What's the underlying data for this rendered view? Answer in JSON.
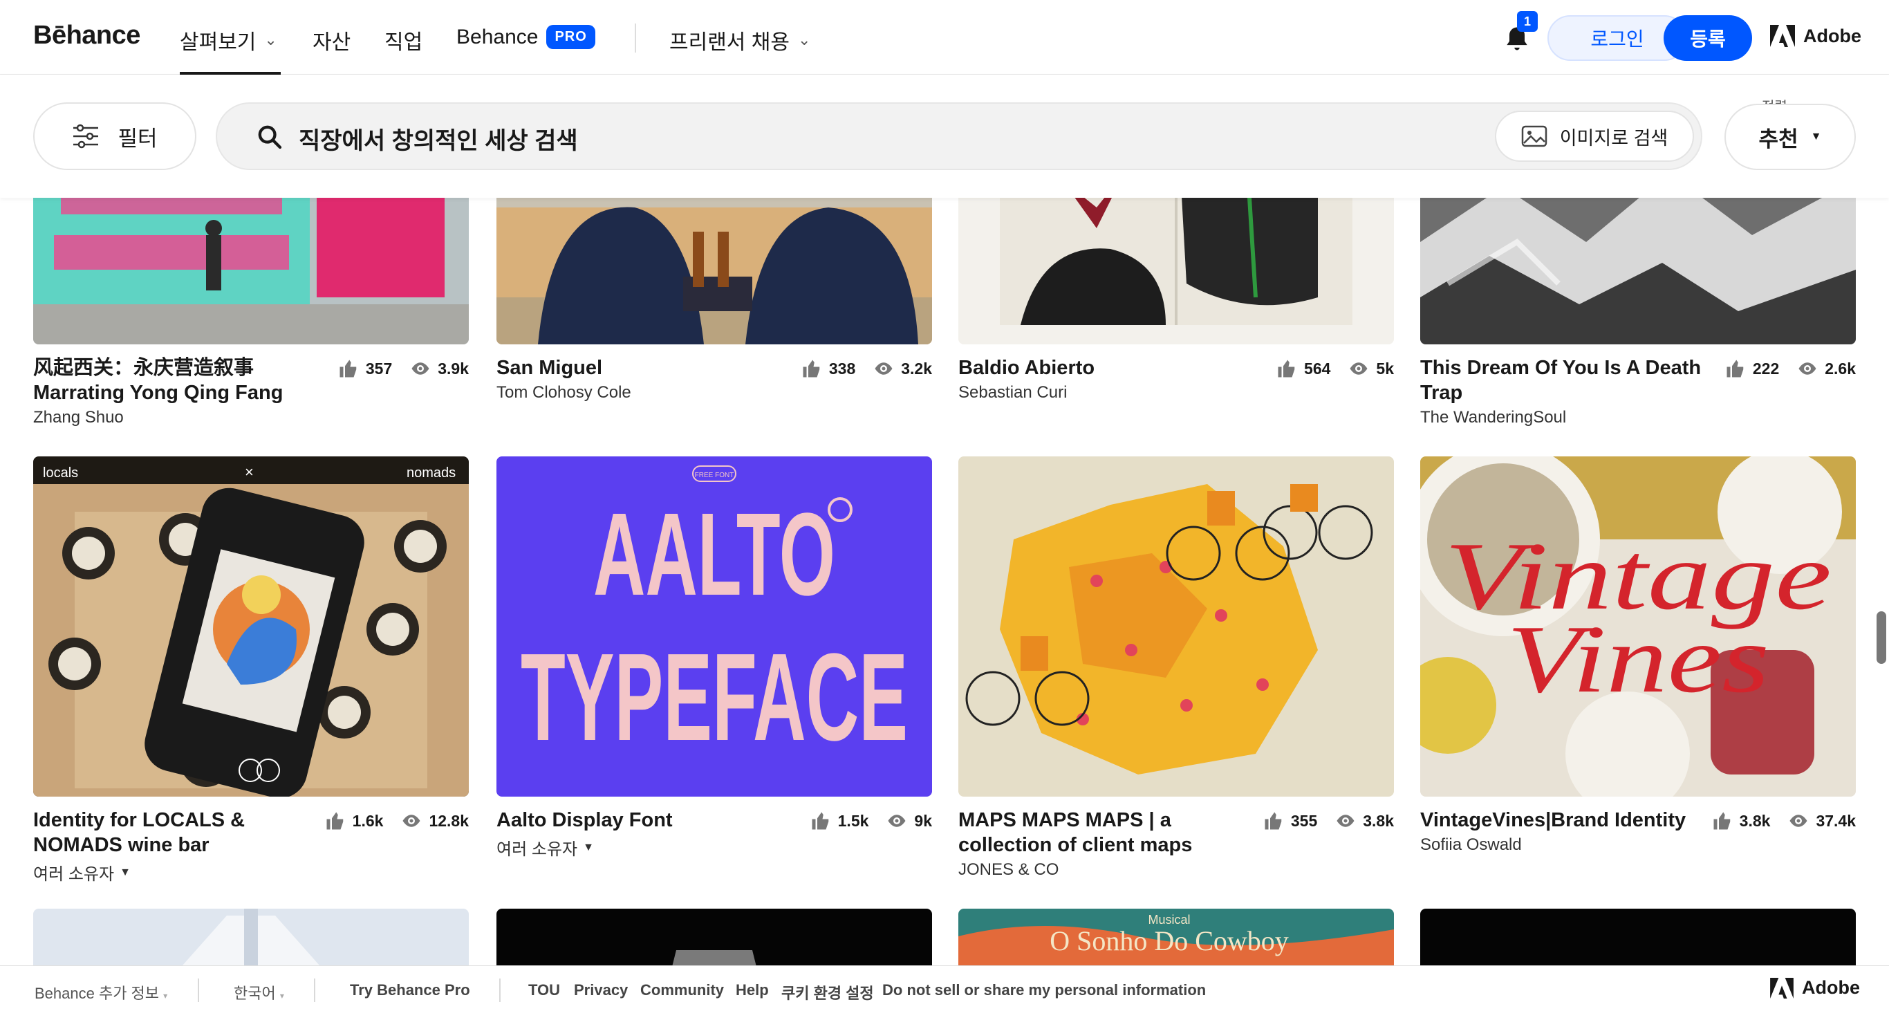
{
  "nav": {
    "logo": "Bēhance",
    "explore": "살펴보기",
    "assets": "자산",
    "jobs": "직업",
    "behance_pro": "Behance",
    "pro_badge": "PRO",
    "hire": "프리랜서 채용",
    "notif_count": "1",
    "login": "로그인",
    "signup": "등록",
    "adobe": "Adobe"
  },
  "search": {
    "filter": "필터",
    "query": "직장에서 창의적인 세상 검색",
    "image_search": "이미지로 검색",
    "sort_label": "정렬",
    "sort_value": "추천"
  },
  "projects": [
    {
      "title": "风起西关：永庆营造叙事 Marrating Yong Qing Fang",
      "owner": "Zhang Shuo",
      "likes": "357",
      "views": "3.9k"
    },
    {
      "title": "San Miguel",
      "owner": "Tom Clohosy Cole",
      "likes": "338",
      "views": "3.2k"
    },
    {
      "title": "Baldio Abierto",
      "owner": "Sebastian Curi",
      "likes": "564",
      "views": "5k"
    },
    {
      "title": "This Dream Of You Is A Death Trap",
      "owner": "The WanderingSoul",
      "likes": "222",
      "views": "2.6k"
    },
    {
      "title": "Identity for LOCALS & NOMADS wine bar",
      "owner": "여러 소유자",
      "likes": "1.6k",
      "views": "12.8k"
    },
    {
      "title": "Aalto Display Font",
      "owner": "여러 소유자",
      "likes": "1.5k",
      "views": "9k"
    },
    {
      "title": "MAPS MAPS MAPS | a collection of client maps",
      "owner": "JONES & CO",
      "likes": "355",
      "views": "3.8k"
    },
    {
      "title": "VintageVines|Brand Identity",
      "owner": "Sofiia Oswald",
      "likes": "3.8k",
      "views": "37.4k"
    }
  ],
  "thumb_text": {
    "locals": "locals",
    "nomads": "nomads",
    "aalto_1": "AALTO",
    "aalto_2": "TYPEFACE",
    "free_font": "FREE FONT",
    "vintage": "Vintage",
    "vines": "Vines",
    "musical": "Musical",
    "cowboy": "O Sonho Do Cowboy"
  },
  "footer": {
    "more_info": "Behance 추가 정보",
    "language": "한국어",
    "try_pro": "Try Behance Pro",
    "tou": "TOU",
    "privacy": "Privacy",
    "community": "Community",
    "help": "Help",
    "cookies": "쿠키 환경 설정",
    "do_not_sell": "Do not sell or share my personal information",
    "adobe": "Adobe"
  },
  "colors": {
    "accent": "#0057ff",
    "aalto_bg": "#5b3ff0",
    "aalto_text": "#f4c6c8"
  }
}
